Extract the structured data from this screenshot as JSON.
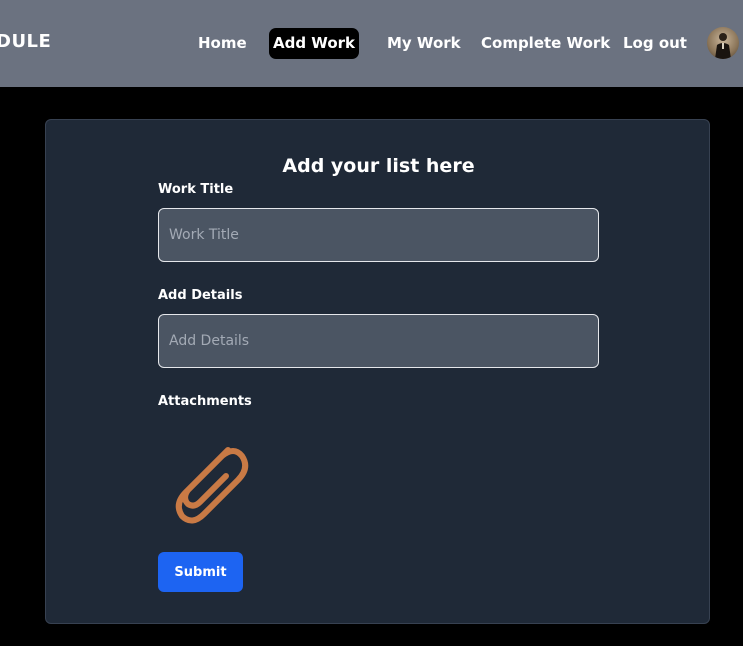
{
  "brand": {
    "text": "DULE"
  },
  "nav": {
    "items": [
      {
        "label": "Home"
      },
      {
        "label": "Add Work",
        "active": true
      },
      {
        "label": "My Work"
      },
      {
        "label": "Complete Work"
      },
      {
        "label": "Log out"
      }
    ],
    "avatar_icon": "user-avatar"
  },
  "form": {
    "title": "Add your list here",
    "work_title": {
      "label": "Work Title",
      "placeholder": "Work Title",
      "value": ""
    },
    "details": {
      "label": "Add Details",
      "placeholder": "Add Details",
      "value": ""
    },
    "attachments": {
      "label": "Attachments",
      "icon": "paperclip-icon",
      "icon_color": "#c97a45"
    },
    "submit_label": "Submit"
  },
  "colors": {
    "navbar_bg": "#6b7280",
    "page_bg": "#000000",
    "card_bg": "#1f2937",
    "input_bg": "#4b5563",
    "submit_bg": "#1d64f2",
    "active_nav_bg": "#000000"
  }
}
